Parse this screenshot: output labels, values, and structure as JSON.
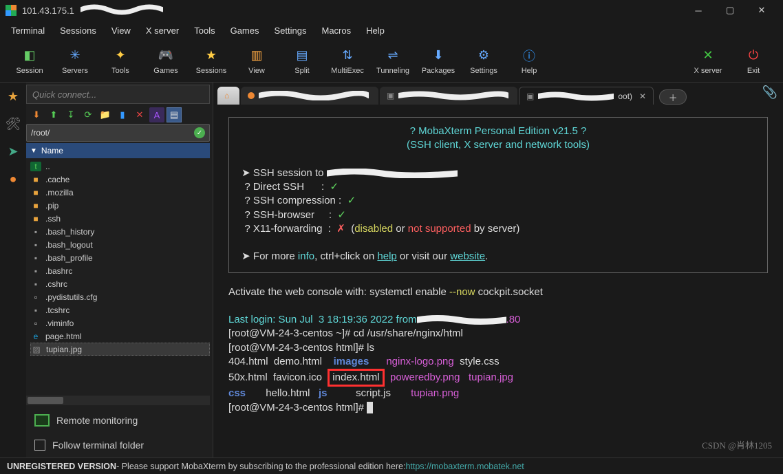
{
  "titlebar": {
    "title": "101.43.175.1"
  },
  "menubar": [
    "Terminal",
    "Sessions",
    "View",
    "X server",
    "Tools",
    "Games",
    "Settings",
    "Macros",
    "Help"
  ],
  "toolbar": {
    "left": [
      {
        "label": "Session",
        "icon": "◧",
        "cls": "ic-session"
      },
      {
        "label": "Servers",
        "icon": "✳",
        "cls": "ic-servers"
      },
      {
        "label": "Tools",
        "icon": "✦",
        "cls": "ic-tools"
      },
      {
        "label": "Games",
        "icon": "🎮",
        "cls": "ic-games"
      },
      {
        "label": "Sessions",
        "icon": "★",
        "cls": "ic-sessions"
      },
      {
        "label": "View",
        "icon": "▥",
        "cls": "ic-view"
      },
      {
        "label": "Split",
        "icon": "▤",
        "cls": "ic-split"
      },
      {
        "label": "MultiExec",
        "icon": "⇅",
        "cls": "ic-multi"
      },
      {
        "label": "Tunneling",
        "icon": "⇌",
        "cls": "ic-tunnel"
      },
      {
        "label": "Packages",
        "icon": "⬇",
        "cls": "ic-pkg"
      },
      {
        "label": "Settings",
        "icon": "⚙",
        "cls": "ic-settings"
      },
      {
        "label": "Help",
        "icon": "ⓘ",
        "cls": "ic-help"
      }
    ],
    "right": [
      {
        "label": "X server",
        "icon": "✕",
        "cls": "ic-xserver"
      },
      {
        "label": "Exit",
        "icon": "⏻",
        "cls": "ic-exit"
      }
    ]
  },
  "sidebar": {
    "quickconnect_placeholder": "Quick connect...",
    "path": "/root/",
    "name_header": "Name",
    "files": [
      {
        "name": "..",
        "type": "up"
      },
      {
        "name": ".cache",
        "type": "folder"
      },
      {
        "name": ".mozilla",
        "type": "folder"
      },
      {
        "name": ".pip",
        "type": "folder"
      },
      {
        "name": ".ssh",
        "type": "folder"
      },
      {
        "name": ".bash_history",
        "type": "file"
      },
      {
        "name": ".bash_logout",
        "type": "file"
      },
      {
        "name": ".bash_profile",
        "type": "file"
      },
      {
        "name": ".bashrc",
        "type": "file"
      },
      {
        "name": ".cshrc",
        "type": "file"
      },
      {
        "name": ".pydistutils.cfg",
        "type": "doc"
      },
      {
        "name": ".tcshrc",
        "type": "file"
      },
      {
        "name": ".viminfo",
        "type": "doc"
      },
      {
        "name": "page.html",
        "type": "edge"
      },
      {
        "name": "tupian.jpg",
        "type": "img",
        "sel": true
      }
    ],
    "remote_monitoring": "Remote monitoring",
    "follow_terminal": "Follow terminal folder"
  },
  "tabs": {
    "active_suffix": "oot)"
  },
  "terminal": {
    "banner_title": "? MobaXterm Personal Edition v21.5 ?",
    "banner_subtitle": "(SSH client, X server and network tools)",
    "ssh_session": "SSH session to ",
    "direct_ssh": "  ? Direct SSH      :  ",
    "ssh_comp": "  ? SSH compression :  ",
    "ssh_browser": "  ? SSH-browser     :  ",
    "x11_fwd": "  ? X11-forwarding  :  ",
    "x11_tail": "by server)",
    "info_prefix": "➤ For more ",
    "info_word": "info",
    "info_mid": ", ctrl+click on ",
    "help_word": "help",
    "info_mid2": " or visit our ",
    "website_word": "website",
    "activate": "Activate the web console with: systemctl enable ",
    "activate_flag": "--now",
    "activate_tail": " cockpit.socket",
    "lastlogin_label": "Last login:",
    "lastlogin_value": " Sun Jul  3 18:19:36 2022 from",
    "lastlogin_tail": ".80",
    "prompt1_user": "root@VM-24-3-centos",
    "prompt1_path": "~",
    "cmd1": "cd /usr/share/nginx/html",
    "prompt2_path": "html",
    "cmd2": "ls",
    "ls_row1": {
      "a": "404.html",
      "b": "demo.html",
      "c": "images",
      "d": "nginx-logo.png",
      "e": "style.css"
    },
    "ls_row2": {
      "a": "50x.html",
      "b": "favicon.ico",
      "c": "index.html",
      "d": "poweredby.png",
      "e": "tupian.jpg"
    },
    "ls_row3": {
      "a": "css",
      "b": "hello.html",
      "c": "js",
      "d": "script.js",
      "e": "tupian.png"
    },
    "watermark": "CSDN @肖林1205"
  },
  "statusbar": {
    "unreg": "UNREGISTERED VERSION",
    "msg": "  -  Please support MobaXterm by subscribing to the professional edition here:  ",
    "url": "https://mobaxterm.mobatek.net"
  }
}
